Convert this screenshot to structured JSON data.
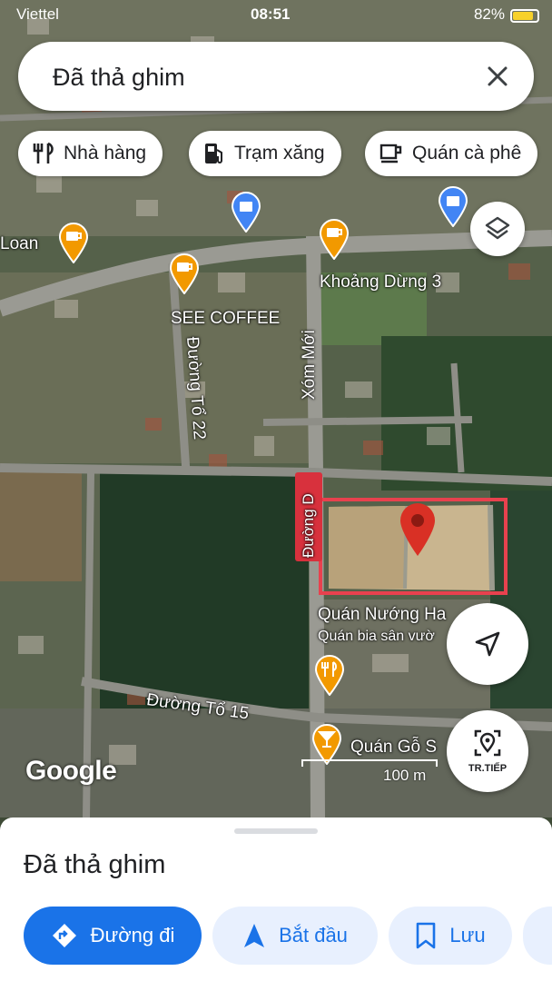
{
  "status_bar": {
    "carrier": "Viettel",
    "time": "08:51",
    "battery": "82%"
  },
  "search": {
    "title": "Đã thả ghim",
    "close_icon": "close-icon"
  },
  "chips": [
    {
      "label": "Nhà hàng",
      "icon": "restaurant-icon"
    },
    {
      "label": "Trạm xăng",
      "icon": "gas-station-icon"
    },
    {
      "label": "Quán cà phê",
      "icon": "coffee-icon"
    }
  ],
  "map": {
    "labels": {
      "loan": "Loan",
      "khoang_dung": "Khoảng Dừng 3",
      "see_coffee": "SEE COFFEE",
      "xom_moi": "Xóm Mới",
      "duong_to_22": "Đường Tổ 22",
      "duong_d": "Đường D",
      "quan_nuong": "Quán Nướng Ha",
      "quan_bia": "Quán bia sân vườ",
      "duong_to_15": "Đường Tổ 15",
      "quan_go": "Quán Gỗ S"
    },
    "google_logo": "Google",
    "scale": "100 m",
    "pin_color": "#d93025"
  },
  "buttons": {
    "layers_icon": "layers-icon",
    "location_icon": "my-location-icon",
    "next_label": "TR.TIẾP"
  },
  "sheet": {
    "title": "Đã thả ghim",
    "actions": [
      {
        "label": "Đường đi",
        "icon": "directions-icon"
      },
      {
        "label": "Bắt đầu",
        "icon": "navigation-arrow-icon"
      },
      {
        "label": "Lưu",
        "icon": "bookmark-icon"
      }
    ]
  }
}
